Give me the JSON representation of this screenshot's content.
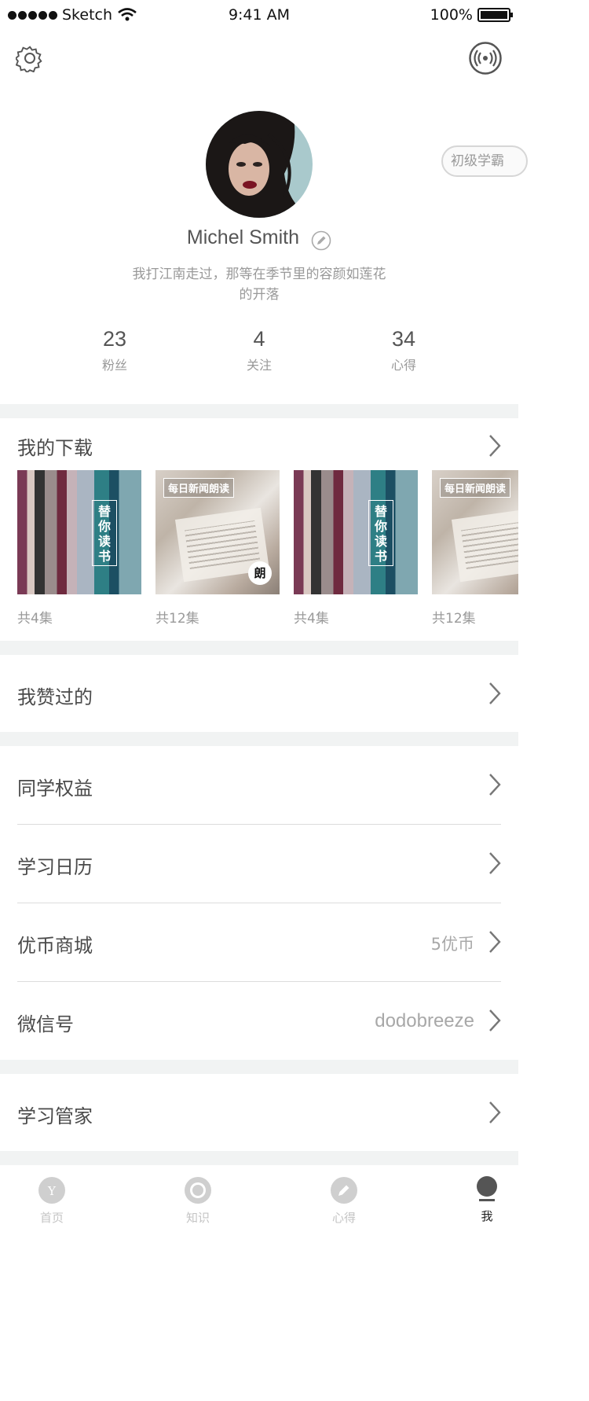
{
  "status_bar": {
    "carrier": "Sketch",
    "time": "9:41 AM",
    "battery": "100%",
    "battery_level": 1.0
  },
  "header": {
    "settings_icon": "gear-icon",
    "broadcast_icon": "broadcast-icon"
  },
  "profile": {
    "name": "Michel Smith",
    "bio_line1": "我打江南走过，那等在季节里的容颜如莲花",
    "bio_line2": "的开落",
    "level_badge": "初级学霸",
    "stats": [
      {
        "value": "23",
        "label": "粉丝"
      },
      {
        "value": "4",
        "label": "关注"
      },
      {
        "value": "34",
        "label": "心得"
      }
    ]
  },
  "downloads": {
    "title": "我的下载",
    "items": [
      {
        "type": "books",
        "overlay": "替你读书",
        "count": "共4集"
      },
      {
        "type": "news",
        "tag": "每日新闻朗读",
        "badge": "朗",
        "count": "共12集"
      },
      {
        "type": "books",
        "overlay": "替你读书",
        "count": "共4集"
      },
      {
        "type": "news",
        "tag": "每日新闻朗读",
        "count": "共12集"
      }
    ]
  },
  "menu": {
    "liked": "我赞过的",
    "rights": "同学权益",
    "calendar": "学习日历",
    "shop": "优币商城",
    "shop_value": "5优币",
    "wechat": "微信号",
    "wechat_value": "dodobreeze",
    "butler": "学习管家"
  },
  "tabbar": {
    "tabs": [
      {
        "label": "首页",
        "icon": "home-icon",
        "icon_letter": "Y"
      },
      {
        "label": "知识",
        "icon": "knowledge-icon"
      },
      {
        "label": "心得",
        "icon": "pencil-icon"
      },
      {
        "label": "我",
        "icon": "profile-icon",
        "active": true
      }
    ]
  },
  "colors": {
    "background": "#ffffff",
    "section_gap": "#f1f3f3",
    "text": "#4a4a4a",
    "muted": "#999999"
  }
}
